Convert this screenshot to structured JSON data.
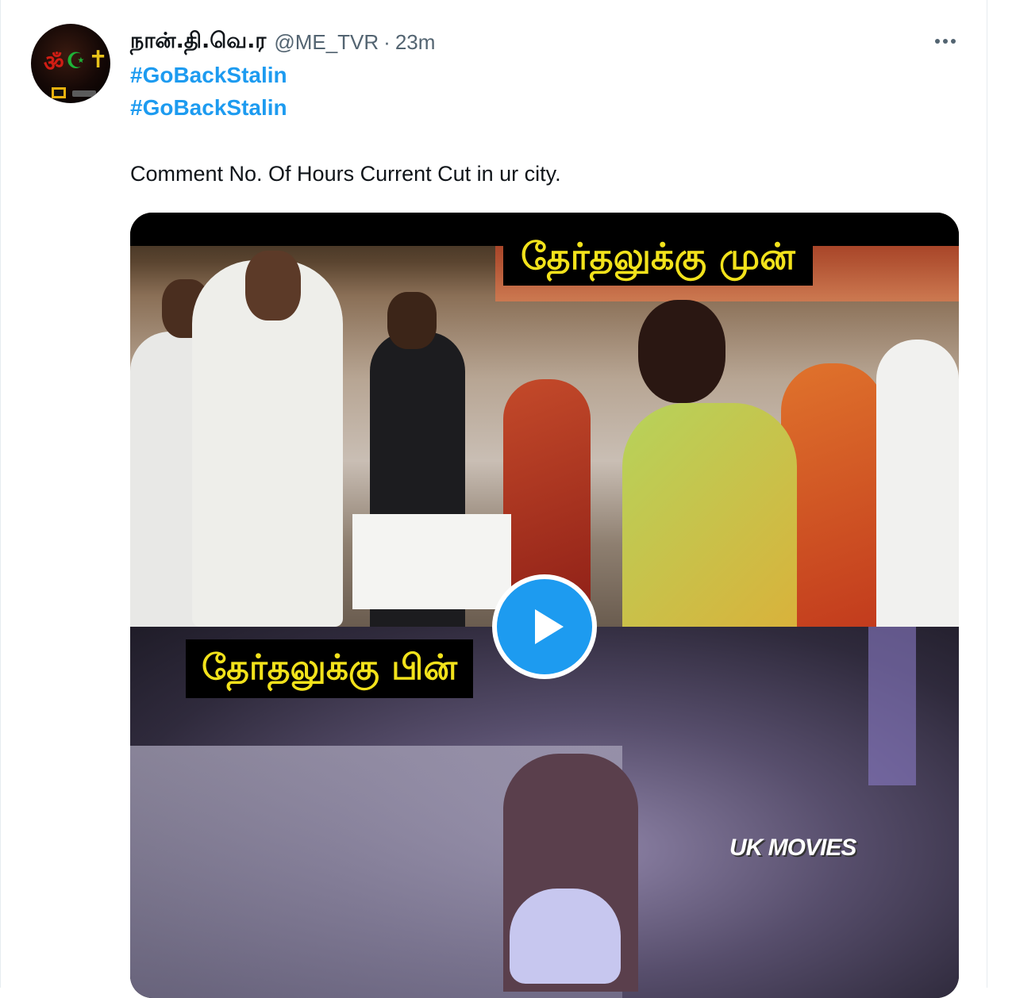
{
  "tweet": {
    "author": {
      "display_name": "நான்.தி.வெ.ர",
      "handle": "@ME_TVR",
      "separator": "·",
      "time": "23m"
    },
    "hashtags": [
      "#GoBackStalin",
      "#GoBackStalin"
    ],
    "text": "Comment No. Of Hours Current Cut in ur city.",
    "media": {
      "type": "video",
      "caption_top": "தேர்தலுக்கு முன்",
      "caption_bottom": "தேர்தலுக்கு பின்",
      "watermark": "UK MOVIES"
    },
    "icons": {
      "more": "more-horizontal-icon",
      "play": "play-icon"
    },
    "colors": {
      "link": "#1d9bf0",
      "text": "#0f1419",
      "secondary": "#536471",
      "caption": "#f2e21b"
    }
  }
}
